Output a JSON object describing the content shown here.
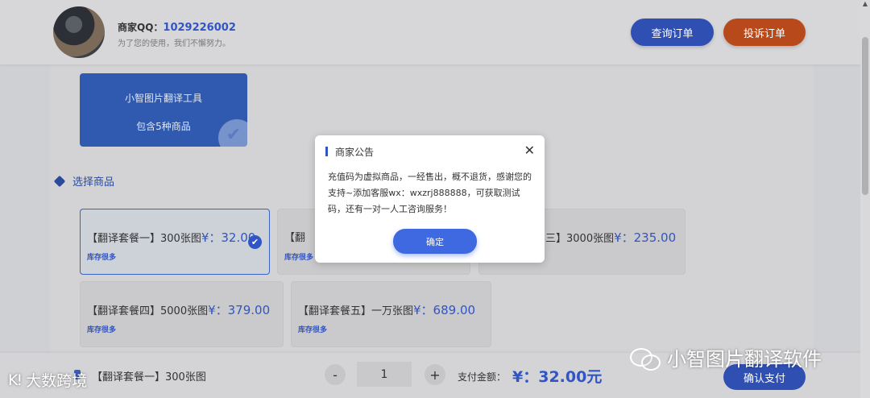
{
  "header": {
    "qq_label": "商家QQ：",
    "qq_number": "1029226002",
    "subtitle": "为了您的使用，我们不懈努力。",
    "query_button": "查询订单",
    "complain_button": "投诉订单"
  },
  "product": {
    "name": "小智图片翻译工具",
    "count_text": "包含5种商品"
  },
  "section": {
    "title": "选择商品"
  },
  "packages": [
    {
      "name": "【翻译套餐一】300张图",
      "price": "¥：32.00",
      "stock": "库存很多",
      "selected": true
    },
    {
      "name": "【翻",
      "price": "",
      "stock": "库存很多",
      "selected": false
    },
    {
      "name": "三】3000张图",
      "price": "¥：235.00",
      "stock": "",
      "selected": false
    },
    {
      "name": "【翻译套餐四】5000张图",
      "price": "¥：379.00",
      "stock": "库存很多",
      "selected": false
    },
    {
      "name": "【翻译套餐五】一万张图",
      "price": "¥：689.00",
      "stock": "库存很多",
      "selected": false
    }
  ],
  "footer": {
    "selected_name": "【翻译套餐一】300张图",
    "minus": "-",
    "quantity": "1",
    "plus": "+",
    "pay_label": "支付金额：",
    "pay_amount": "¥：32.00元",
    "confirm": "确认支付"
  },
  "modal": {
    "title": "商家公告",
    "close": "✕",
    "body": "充值码为虚拟商品，一经售出，概不退货，感谢您的支持~添加客服wx：wxzrj888888，可获取测试码，还有一对一人工咨询服务！",
    "ok": "确定"
  },
  "watermarks": {
    "right": "小智图片翻译软件",
    "left_logo": "K!",
    "left": "大数跨境"
  },
  "colors": {
    "accent_blue": "#2f55c6",
    "complain_orange": "#b8491b",
    "modal_button": "#3f69e0"
  },
  "icons": {
    "selected_check": "✔",
    "close": "✕",
    "section_marker": "diamond-check-icon"
  }
}
